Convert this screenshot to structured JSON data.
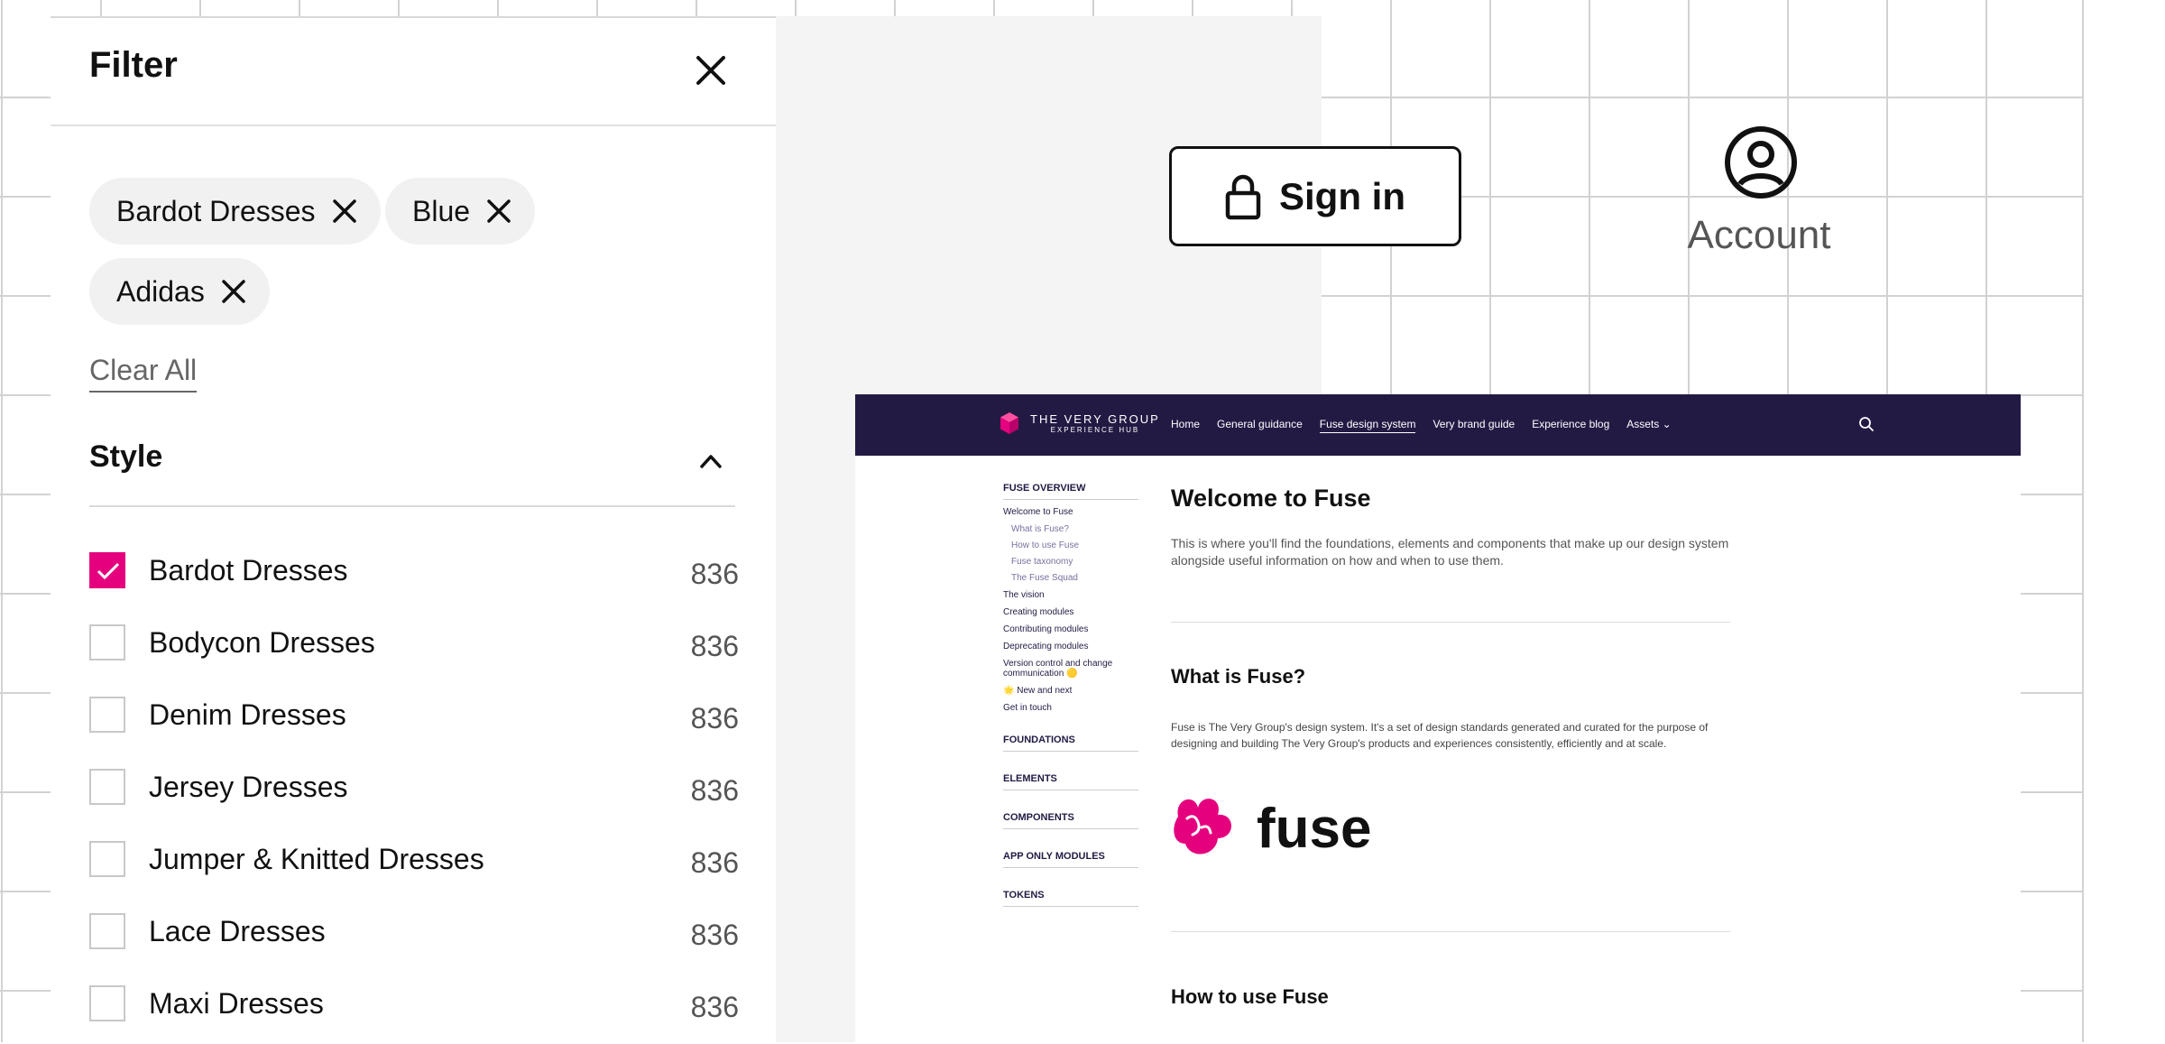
{
  "filter": {
    "title": "Filter",
    "chips": [
      {
        "label": "Bardot Dresses"
      },
      {
        "label": "Blue"
      },
      {
        "label": "Adidas"
      }
    ],
    "clear_all": "Clear All",
    "style_title": "Style",
    "options": [
      {
        "label": "Bardot Dresses",
        "count": "836",
        "checked": true
      },
      {
        "label": "Bodycon Dresses",
        "count": "836",
        "checked": false
      },
      {
        "label": "Denim Dresses",
        "count": "836",
        "checked": false
      },
      {
        "label": "Jersey Dresses",
        "count": "836",
        "checked": false
      },
      {
        "label": "Jumper & Knitted Dresses",
        "count": "836",
        "checked": false
      },
      {
        "label": "Lace Dresses",
        "count": "836",
        "checked": false
      },
      {
        "label": "Maxi Dresses",
        "count": "836",
        "checked": false
      }
    ]
  },
  "signin": {
    "label": "Sign in"
  },
  "account": {
    "label": "Account"
  },
  "site": {
    "brand_main": "THE VERY GROUP",
    "brand_sub": "EXPERIENCE HUB",
    "nav": [
      {
        "label": "Home"
      },
      {
        "label": "General guidance"
      },
      {
        "label": "Fuse design system"
      },
      {
        "label": "Very brand guide"
      },
      {
        "label": "Experience blog"
      },
      {
        "label": "Assets ⌄"
      }
    ],
    "sidebar": {
      "overview": "FUSE OVERVIEW",
      "welcome": "Welcome to Fuse",
      "sub": [
        "What is Fuse?",
        "How to use Fuse",
        "Fuse taxonomy",
        "The Fuse Squad"
      ],
      "links": [
        "The vision",
        "Creating modules",
        "Contributing modules",
        "Deprecating modules",
        "Version control and change communication 🟡",
        "🌟 New and next",
        "Get in touch"
      ],
      "sections": [
        "FOUNDATIONS",
        "ELEMENTS",
        "COMPONENTS",
        "APP ONLY MODULES",
        "TOKENS"
      ]
    },
    "content": {
      "title": "Welcome to Fuse",
      "intro": "This is where you'll find the foundations, elements and components that make up our design system alongside useful information on how and when to use them.",
      "h_what": "What is Fuse?",
      "what_body": "Fuse is The Very Group's design system. It's a set of design standards generated and curated for the purpose of designing and building The Very Group's products and experiences consistently, efficiently and at scale.",
      "logo_text": "fuse",
      "h_how": "How to use Fuse"
    }
  },
  "colors": {
    "accent": "#e5007d",
    "nav_bg": "#231a44"
  }
}
